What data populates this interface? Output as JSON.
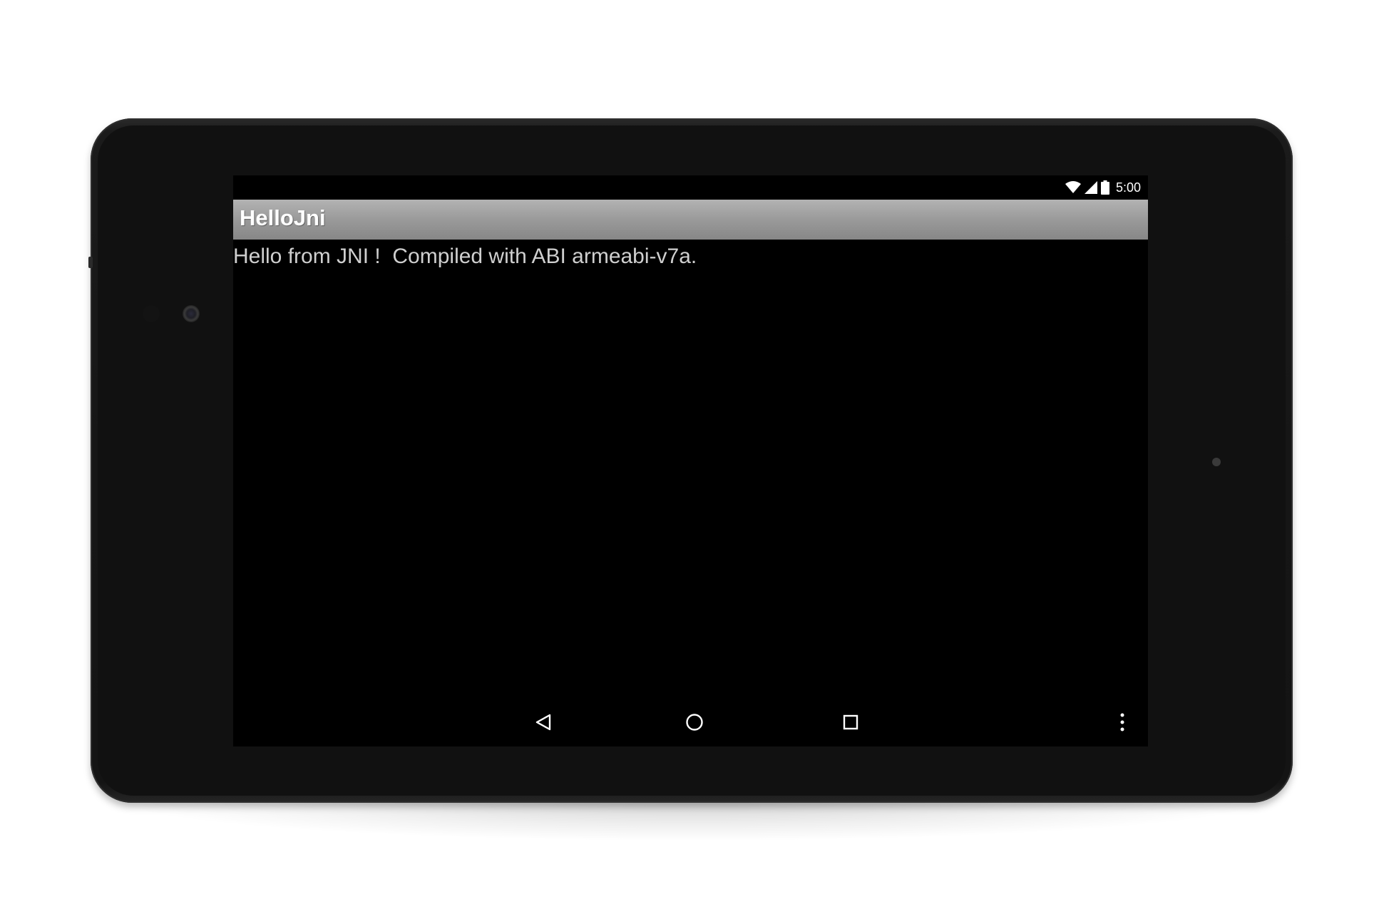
{
  "status_bar": {
    "time": "5:00",
    "icons": [
      "wifi-icon",
      "cell-signal-icon",
      "battery-icon"
    ]
  },
  "action_bar": {
    "title": "HelloJni"
  },
  "content": {
    "message": "Hello from JNI !  Compiled with ABI armeabi-v7a."
  },
  "nav_bar": {
    "buttons": [
      "back-icon",
      "home-icon",
      "recents-icon",
      "overflow-menu-icon"
    ]
  },
  "colors": {
    "action_bar": "#9a9a9a",
    "screen_bg": "#000000",
    "text": "#cfcfcf",
    "device_bezel": "#141414"
  }
}
